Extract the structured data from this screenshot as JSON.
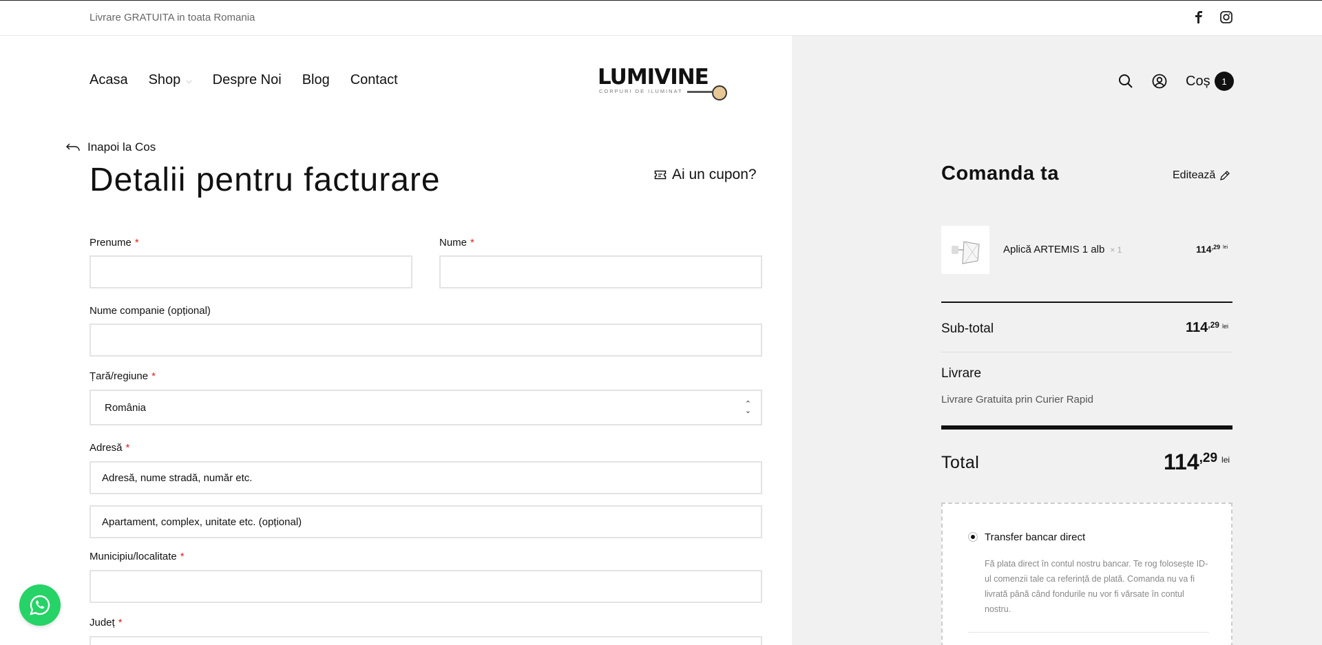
{
  "topbar": {
    "text": "Livrare GRATUITA in toata Romania",
    "facebook_icon": "facebook-icon",
    "instagram_icon": "instagram-icon"
  },
  "header": {
    "nav": [
      {
        "label": "Acasa"
      },
      {
        "label": "Shop",
        "has_dropdown": true
      },
      {
        "label": "Despre Noi"
      },
      {
        "label": "Blog"
      },
      {
        "label": "Contact"
      }
    ],
    "logo": {
      "word": "LUMIVINE",
      "tagline": "CORPURI DE ILUMINAT"
    },
    "search_icon": "search-icon",
    "account_icon": "user-icon",
    "cart_label": "Coș",
    "cart_count": "1"
  },
  "billing": {
    "back_label": "Inapoi la Cos",
    "title": "Detalii pentru facturare",
    "coupon_label": "Ai un cupon?",
    "first_name": {
      "label": "Prenume",
      "required": "*",
      "value": ""
    },
    "last_name": {
      "label": "Nume",
      "required": "*",
      "value": ""
    },
    "company": {
      "label": "Nume companie (opțional)",
      "value": ""
    },
    "country": {
      "label": "Țară/regiune",
      "required": "*",
      "value": "România"
    },
    "address": {
      "label": "Adresă",
      "required": "*",
      "placeholder1": "Adresă, nume stradă, număr etc.",
      "placeholder2": "Apartament, complex, unitate etc. (opțional)"
    },
    "city": {
      "label": "Municipiu/localitate",
      "required": "*",
      "value": ""
    },
    "county": {
      "label": "Județ",
      "required": "*"
    }
  },
  "order": {
    "title": "Comanda ta",
    "edit_label": "Editează",
    "item": {
      "name": "Aplică ARTEMIS 1 alb",
      "qty": "× 1",
      "price_int": "114",
      "price_dec": ",29",
      "currency": "lei"
    },
    "subtotal": {
      "label": "Sub-total",
      "price_int": "114",
      "price_dec": ",29",
      "currency": "lei"
    },
    "shipping": {
      "label": "Livrare",
      "value": "Livrare Gratuita prin Curier Rapid"
    },
    "total": {
      "label": "Total",
      "price_int": "114",
      "price_dec": ",29",
      "currency": "lei"
    },
    "payment": {
      "method": "Transfer bancar direct",
      "selected": true,
      "description": "Fă plata direct în contul nostru bancar. Te rog folosește ID-ul comenzii tale ca referință de plată. Comanda nu va fi livrată până când fondurile nu vor fi vărsate în contul nostru."
    }
  },
  "colors": {
    "accent": "#111111",
    "required": "#e02020",
    "panel": "#f1f1f1",
    "whatsapp": "#25d366"
  }
}
